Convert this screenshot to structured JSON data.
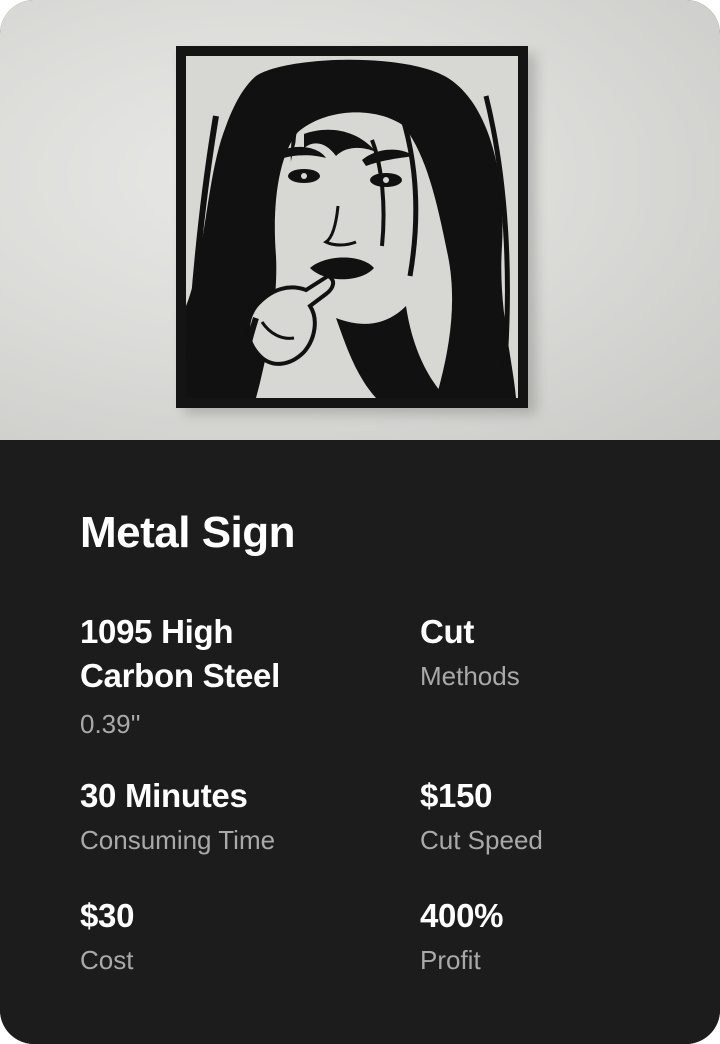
{
  "product": {
    "image_subject": "metal-cut-portrait-wall-art",
    "title": "Metal Sign"
  },
  "stats": {
    "material": {
      "value_line1": "1095 High",
      "value_line2": "Carbon Steel",
      "label": "0.39''"
    },
    "method": {
      "value": "Cut",
      "label": "Methods"
    },
    "time": {
      "value": "30 Minutes",
      "label": "Consuming Time"
    },
    "speed": {
      "value": "$150",
      "label": "Cut Speed"
    },
    "cost": {
      "value": "$30",
      "label": "Cost"
    },
    "profit": {
      "value": "400%",
      "label": "Profit"
    }
  },
  "colors": {
    "card_background": "#1c1c1c",
    "text_primary": "#ffffff",
    "text_secondary": "#a9a9a9",
    "wall": "#dcdcd9",
    "metal": "#141414"
  }
}
